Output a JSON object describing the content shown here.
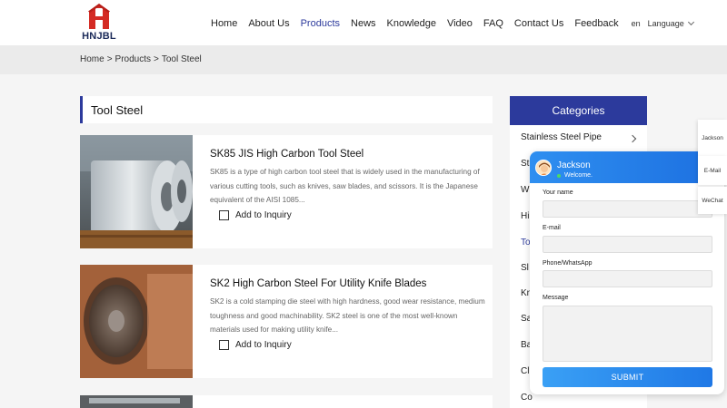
{
  "brand": {
    "name": "HNJBL",
    "logo_color": "#d42b24",
    "text_color": "#1b2a59"
  },
  "nav": {
    "items": [
      "Home",
      "About Us",
      "Products",
      "News",
      "Knowledge",
      "Video",
      "FAQ",
      "Contact Us",
      "Feedback"
    ],
    "active": "Products",
    "lang_code": "en",
    "language_label": "Language"
  },
  "breadcrumb": {
    "home": "Home",
    "sep": ">",
    "products": "Products",
    "current": "Tool Steel"
  },
  "section_title": "Tool Steel",
  "products": [
    {
      "title": "SK85 JIS High Carbon Tool Steel",
      "description": "SK85 is a type of high carbon tool steel that is widely used in the manufacturing of various cutting tools, such as knives, saw blades, and scissors. It is the Japanese equivalent of the AISI 1085...",
      "inquiry_label": "Add to Inquiry",
      "image_icon": "steel-coil-image"
    },
    {
      "title": "SK2 High Carbon Steel For Utility Knife Blades",
      "description": "SK2 is a cold stamping die steel with high hardness, good wear resistance, medium toughness and good machinability. SK2 steel is one of the most well-known materials used for making utility knife...",
      "inquiry_label": "Add to Inquiry",
      "image_icon": "steel-bar-end-image"
    }
  ],
  "categories": {
    "header": "Categories",
    "items": [
      "Stainless Steel Pipe",
      "St",
      "W",
      "Hi",
      "To",
      "Sl",
      "Kn",
      "Sa",
      "Ba",
      "Cl",
      "Co"
    ],
    "active_index": 4
  },
  "chat": {
    "agent": "Jackson",
    "welcome": "Welcome.",
    "name_label": "Your name",
    "email_label": "E-mail",
    "phone_label": "Phone/WhatsApp",
    "message_label": "Message",
    "submit_label": "SUBMIT"
  },
  "side_tabs": {
    "jackson": "Jackson",
    "email": "E-Mail",
    "wechat": "WeChat"
  },
  "colors": {
    "accent": "#2c3a9c",
    "chat_blue": "#1f78e6",
    "online": "#4cd964"
  }
}
